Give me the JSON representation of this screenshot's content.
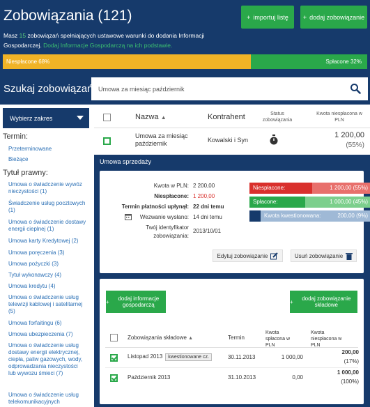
{
  "header": {
    "title": "Zobowiązania (121)",
    "import_label": "importuj listę",
    "add_label": "dodaj zobowiązanie",
    "desc_pre": "Masz ",
    "desc_num": "15",
    "desc_mid": " zobowiązań spełniających ustawowe warunki do dodania Informacji Gospodarczej. ",
    "desc_link": "Dodaj Informacje Gospodarczą na ich podstawie.",
    "progress_unpaid_label": "Niespłacone 68%",
    "progress_paid_label": "Spłacone 32%",
    "progress_unpaid_pct": 68,
    "progress_paid_pct": 32
  },
  "search": {
    "label": "Szukaj zobowiązań:",
    "value": "Umowa za miesiąc październik"
  },
  "sidebar": {
    "range_label": "Wybierz zakres",
    "term_heading": "Termin:",
    "term_items": [
      "Przeterminowane",
      "Bieżące"
    ],
    "title_heading": "Tytuł prawny:",
    "title_items": [
      "Umowa o świadczenie wywóz nieczystości (1)",
      "Świadczenie usług pocztowych (1)",
      "Umowa o świadczenie dostawy energii cieplnej (1)",
      "Umowa karty Kredytowej (2)",
      "Umowa poręczenia (3)",
      "Umowa pożyczki (3)",
      "Tytuł wykonawczy (4)",
      "Umowa kredytu (4)",
      "Umowa o świadczenie usług telewizji kablowej i satelitarnej (5)",
      "Umowa forfaitingu (6)",
      "Umowa ubezpieczenia (7)",
      "Umowa o świadczenie usług dostawy energii elektrycznej, ciepła, paliw gazowych, wody, odprowadzania nieczystości lub wywozu śmieci (7)",
      "Umowa o świadczenie usług telekomunikacyjnych"
    ]
  },
  "table": {
    "col_name": "Nazwa",
    "col_contractor": "Kontrahent",
    "col_status": "Status zobowiązania",
    "col_amount": "Kwota niespłacona w PLN",
    "row": {
      "name": "Umowa za miesiąc październik",
      "contractor": "Kowalski i Syn",
      "amount": "1 200,00",
      "pct": "(55%)"
    }
  },
  "detail": {
    "title": "Umowa sprzedaży",
    "amount_label": "Kwota w PLN:",
    "amount_value": "2 200,00",
    "unpaid_label": "Niespłacone:",
    "unpaid_value": "1 200,00",
    "due_label": "Termin płatności upłynął:",
    "due_value": "22 dni temu",
    "summons_label": "Wezwanie wysłano:",
    "summons_value": "14 dni temu",
    "id_label": "Twój identyfikator zobowiązania:",
    "id_value": "2013/10/01",
    "stats": [
      {
        "label": "Niespłacone:",
        "value": "1 200,00 (55%)",
        "color": "#d9302c",
        "light": "#e8706c"
      },
      {
        "label": "Spłacone:",
        "value": "1 000,00 (45%)",
        "color": "#2aa84a",
        "light": "#7ccf8c"
      },
      {
        "label": "Kwota kwestionowana:",
        "value": "200,00 (9%)",
        "color": "#4f7fb5",
        "light": "#9fb9d6"
      }
    ],
    "edit_label": "Edytuj zobowiązanie",
    "delete_label": "Usuń zobowiązanie",
    "add_info_label": "dodaj informacje gospodarczą",
    "add_sub_label": "dodaj zobowiązanie składowe",
    "sub_cols": {
      "name": "Zobowiązania składowe",
      "term": "Termin",
      "paid": "Kwota spłacona w PLN",
      "unpaid": "Kwota niespłacona w PLN"
    },
    "sub_rows": [
      {
        "name": "Listopad 2013",
        "badge": "kwestionowane cz.",
        "term": "30.11.2013",
        "paid": "1 000,00",
        "unpaid": "200,00",
        "pct": "(17%)"
      },
      {
        "name": "Październik 2013",
        "badge": "",
        "term": "31.10.2013",
        "paid": "0,00",
        "unpaid": "1 000,00",
        "pct": "(100%)"
      }
    ]
  }
}
